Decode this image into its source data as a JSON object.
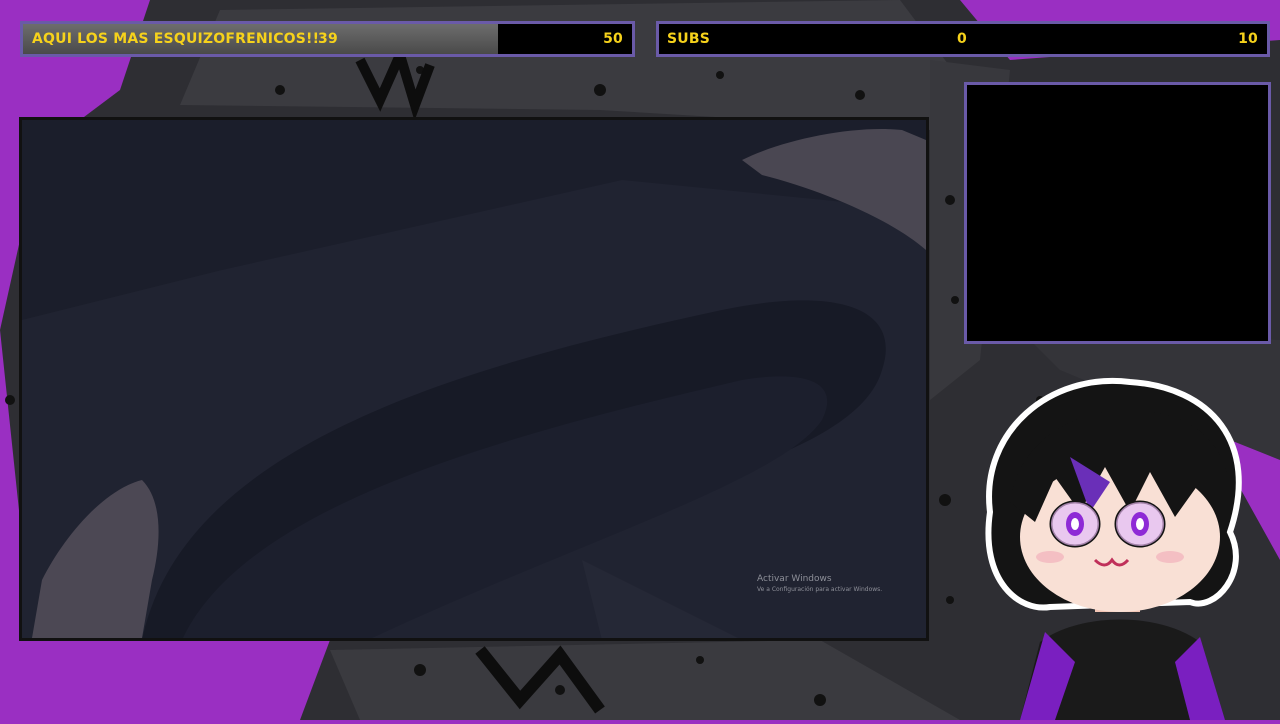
{
  "goal_left": {
    "label": "AQUI LOS MAS ESQUIZOFRENICOS!!",
    "current": "39",
    "target": "50",
    "progress": 0.78
  },
  "goal_right": {
    "label": "SUBS",
    "current": "0",
    "target": "10",
    "progress": 0
  },
  "game": {
    "watermark_title": "Activar Windows",
    "watermark_sub": "Ve a Configuración para activar Windows."
  },
  "colors": {
    "accent": "#6a5aa8",
    "text": "#f6d21b",
    "brand_purple": "#9a2fc2"
  },
  "icons": {
    "avatar": "vtuber-avatar-illustration"
  }
}
